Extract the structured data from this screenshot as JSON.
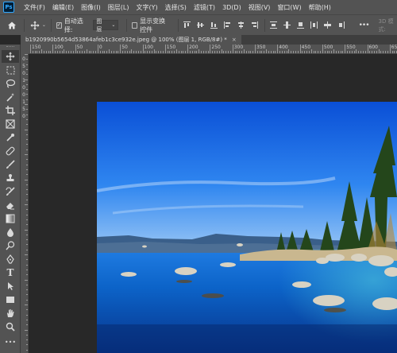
{
  "app": {
    "logo": "Ps"
  },
  "menu": [
    "文件(F)",
    "编辑(E)",
    "图像(I)",
    "图层(L)",
    "文字(Y)",
    "选择(S)",
    "滤镜(T)",
    "3D(D)",
    "视图(V)",
    "窗口(W)",
    "帮助(H)"
  ],
  "options": {
    "home_icon": "home-icon",
    "move_icon": "move-icon",
    "auto_select_label": "自动选择:",
    "auto_select_checked": true,
    "auto_select_target": "图层",
    "show_transform_label": "显示变换控件",
    "show_transform_checked": false,
    "more_label": "•••",
    "mode_3d_label": "3D 模式:"
  },
  "document": {
    "tab_title": "b1920990b5654d53864afeb1c3ce932e.jpeg @ 100% (图层 1, RGB/8#) *",
    "close_label": "×"
  },
  "ruler": {
    "top_labels": [
      "150",
      "100",
      "50",
      "0",
      "50",
      "100",
      "150",
      "200",
      "250",
      "300",
      "350",
      "400",
      "450",
      "500",
      "550",
      "600",
      "650"
    ],
    "left_labels": [
      "0",
      "5",
      "0",
      "1",
      "0",
      "0",
      "1",
      "5",
      "0"
    ]
  },
  "tools": [
    {
      "name": "move-tool",
      "icon": "move-icon"
    },
    {
      "name": "marquee-tool",
      "icon": "marquee-icon"
    },
    {
      "name": "lasso-tool",
      "icon": "lasso-icon"
    },
    {
      "name": "magic-wand-tool",
      "icon": "magic-wand-icon"
    },
    {
      "name": "crop-tool",
      "icon": "crop-icon"
    },
    {
      "name": "frame-tool",
      "icon": "frame-icon"
    },
    {
      "name": "eyedropper-tool",
      "icon": "eyedropper-icon"
    },
    {
      "name": "healing-brush-tool",
      "icon": "bandage-icon"
    },
    {
      "name": "brush-tool",
      "icon": "brush-icon"
    },
    {
      "name": "clone-stamp-tool",
      "icon": "stamp-icon"
    },
    {
      "name": "history-brush-tool",
      "icon": "history-brush-icon"
    },
    {
      "name": "eraser-tool",
      "icon": "eraser-icon"
    },
    {
      "name": "gradient-tool",
      "icon": "gradient-icon"
    },
    {
      "name": "blur-tool",
      "icon": "drop-icon"
    },
    {
      "name": "dodge-tool",
      "icon": "dodge-icon"
    },
    {
      "name": "pen-tool",
      "icon": "pen-icon"
    },
    {
      "name": "type-tool",
      "icon": "type-icon"
    },
    {
      "name": "path-selection-tool",
      "icon": "arrow-icon"
    },
    {
      "name": "rectangle-tool",
      "icon": "rectangle-icon"
    },
    {
      "name": "hand-tool",
      "icon": "hand-icon"
    },
    {
      "name": "zoom-tool",
      "icon": "zoom-icon"
    }
  ],
  "colors": {
    "ui_panel": "#535353",
    "workspace": "#282828",
    "accent": "#31a8ff"
  }
}
